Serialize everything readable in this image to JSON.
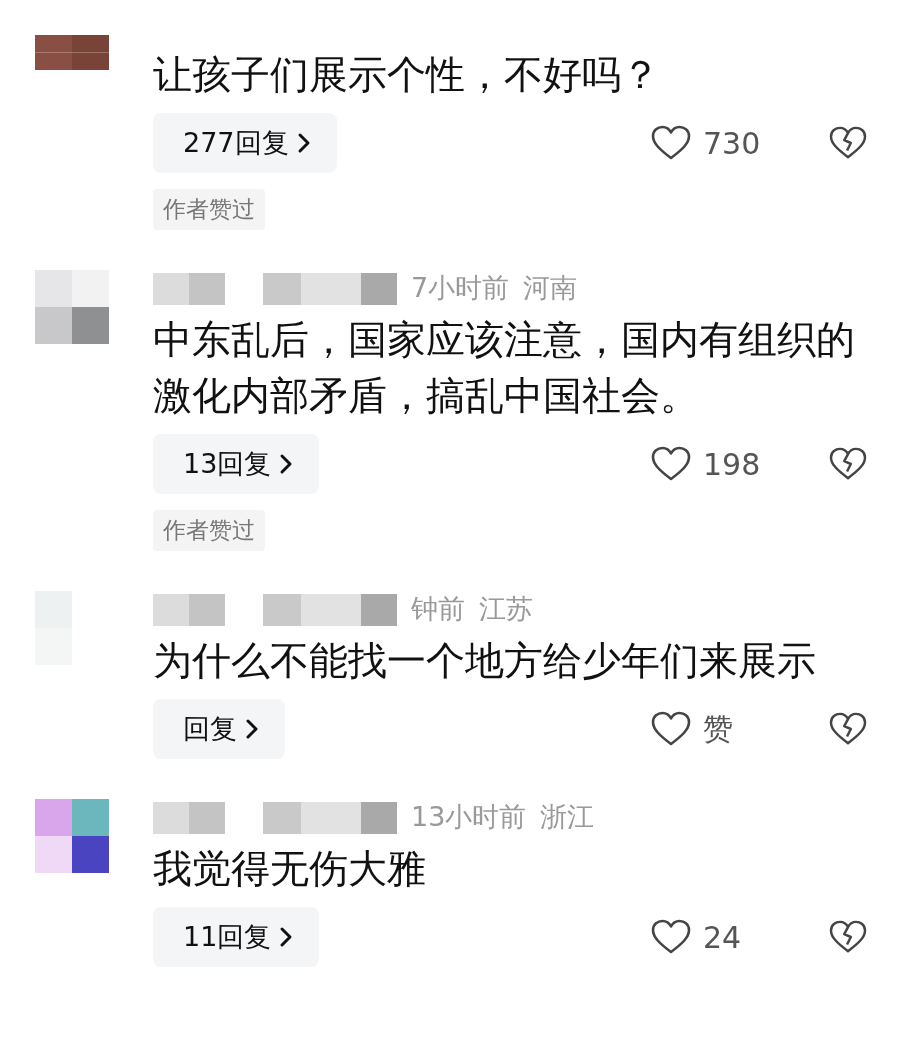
{
  "comments": [
    {
      "text": "让孩子们展示个性，不好吗？",
      "reply_label": "277回复",
      "like_label": "730",
      "badge": "作者赞过"
    },
    {
      "time": "7小时前",
      "region": "河南",
      "text": "中东乱后，国家应该注意，国内有组织的激化内部矛盾，搞乱中国社会。",
      "reply_label": "13回复",
      "like_label": "198",
      "badge": "作者赞过"
    },
    {
      "time": "钟前",
      "region": "江苏",
      "text": "为什么不能找一个地方给少年们来展示",
      "reply_label": "回复",
      "like_label": "赞"
    },
    {
      "time": "13小时前",
      "region": "浙江",
      "text": "我觉得无伤大雅",
      "reply_label": "11回复",
      "like_label": "24"
    }
  ]
}
